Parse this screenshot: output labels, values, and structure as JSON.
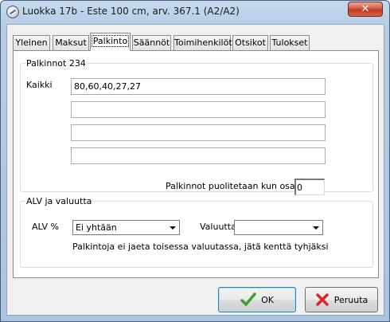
{
  "window": {
    "title": "Luokka 17b - Este 100 cm, arv. 367.1 (A2/A2)",
    "close_glyph": "✕"
  },
  "tabs": [
    {
      "label": "Yleinen"
    },
    {
      "label": "Maksut"
    },
    {
      "label": "Palkinto",
      "active": true
    },
    {
      "label": "Säännöt"
    },
    {
      "label": "Toimihenkilöt"
    },
    {
      "label": "Otsikot"
    },
    {
      "label": "Tulokset"
    }
  ],
  "prizes": {
    "group_label": "Palkinnot 234",
    "all_label": "Kaikki",
    "fields": [
      "80,60,40,27,27",
      "",
      "",
      ""
    ],
    "split_label": "Palkinnot puolitetaan kun osall. vä",
    "split_value": "0"
  },
  "vat": {
    "group_label": "ALV ja valuutta",
    "vat_label": "ALV %",
    "vat_value": "Ei yhtään",
    "currency_label": "Valuutta",
    "currency_value": "",
    "note": "Palkintoja ei jaeta toisessa valuutassa, jätä kenttä tyhjäksi"
  },
  "buttons": {
    "ok": "OK",
    "cancel": "Peruuta"
  },
  "icons": {
    "app": "application-icon",
    "ok": "check-icon",
    "cancel": "cross-icon"
  },
  "colors": {
    "ok_icon": "#3aa02a",
    "cancel_icon": "#d8262a",
    "close_button": "#c3371f"
  }
}
